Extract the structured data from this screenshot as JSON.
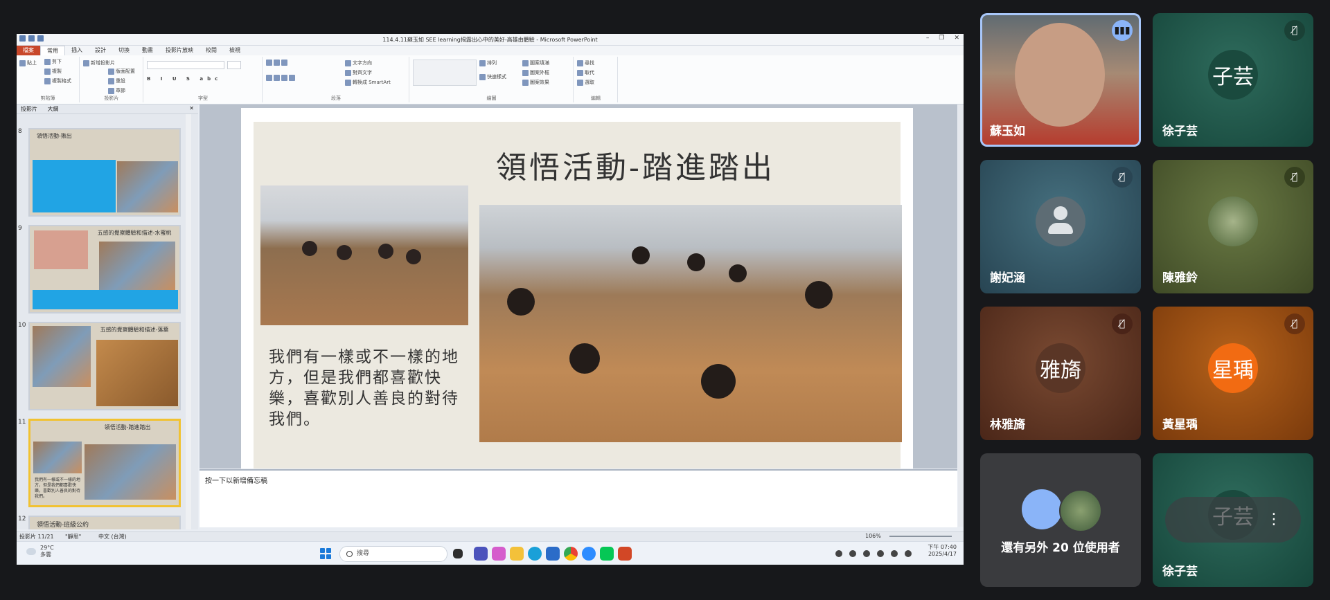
{
  "ppt": {
    "title": "114.4.11蘇玉如 SEE learning揭露出心中的美好-高雄由體驗 - Microsoft PowerPoint",
    "tabs": [
      "檔案",
      "常用",
      "插入",
      "設計",
      "切換",
      "動畫",
      "投影片放映",
      "校閱",
      "檢視"
    ],
    "ribbon_groups": [
      "剪貼簿",
      "投影片",
      "字型",
      "段落",
      "繪圖",
      "編輯"
    ],
    "clipboard_items": [
      "貼上",
      "剪下",
      "複製",
      "複製格式"
    ],
    "slide_items": [
      "新增投影片",
      "版面配置",
      "重設",
      "章節"
    ],
    "paragraph_items": [
      "文字方向",
      "對齊文字",
      "轉換成 SmartArt"
    ],
    "drawing_items": [
      "排列",
      "快速樣式",
      "圖案填滿",
      "圖案外框",
      "圖案效果"
    ],
    "editing_items": [
      "尋找",
      "取代",
      "選取"
    ],
    "pane_tabs": [
      "投影片",
      "大綱"
    ],
    "thumbnails": [
      {
        "num": "8",
        "title": "領悟活動-揪出"
      },
      {
        "num": "9",
        "title": "五感的覺察體驗和描述-水蜜桃"
      },
      {
        "num": "10",
        "title": "五感的覺察體驗和描述-落葉"
      },
      {
        "num": "11",
        "title": "領悟活動-踏進踏出",
        "text": "我們有一樣或不一樣的地方，但是我們都喜歡快樂，喜歡別人善良的對待我們。"
      },
      {
        "num": "12",
        "title": "領悟活動-班級公約"
      }
    ],
    "slide": {
      "title": "領悟活動-踏進踏出",
      "body": "我們有一樣或不一樣的地方，但是我們都喜歡快樂，喜歡別人善良的對待我們。"
    },
    "notes_placeholder": "按一下以新增備忘稿",
    "status": {
      "slide_count": "投影片 11/21",
      "theme": "\"靜思\"",
      "language": "中文 (台灣)",
      "zoom": "106%"
    }
  },
  "taskbar": {
    "temp": "29°C",
    "weather": "多雲",
    "search_placeholder": "搜尋",
    "time": "下午 07:40",
    "date": "2025/4/17"
  },
  "meet": {
    "tiles": [
      {
        "name": "蘇玉如",
        "avatar": "",
        "muted": false,
        "speaking": true,
        "bg": "#6b6b66"
      },
      {
        "name": "徐子芸",
        "avatar": "子芸",
        "muted": true,
        "speaking": false,
        "bg": "#1c5a4c"
      },
      {
        "name": "謝妃涵",
        "avatar": "",
        "muted": true,
        "speaking": false,
        "bg": "#2e5060"
      },
      {
        "name": "陳雅鈴",
        "avatar": "",
        "muted": true,
        "speaking": false,
        "bg": "#4e5a30"
      },
      {
        "name": "林雅旖",
        "avatar": "雅旖",
        "muted": true,
        "speaking": false,
        "bg": "#5a3220"
      },
      {
        "name": "黃星瑀",
        "avatar": "星瑀",
        "muted": true,
        "speaking": false,
        "bg": "#8a4b12"
      },
      {
        "name": "還有另外 20 位使用者",
        "avatar": "",
        "muted": false,
        "speaking": false,
        "bg": "#3a3b3e"
      },
      {
        "name": "徐子芸",
        "avatar": "子芸",
        "muted": false,
        "speaking": false,
        "bg": "#1c5a4c"
      }
    ]
  },
  "colors": {
    "file_tab": "#c8472a",
    "selected_thumb": "#f1c232",
    "accent_blue": "#21a4e4",
    "speaking_border": "#a8c7fa"
  }
}
